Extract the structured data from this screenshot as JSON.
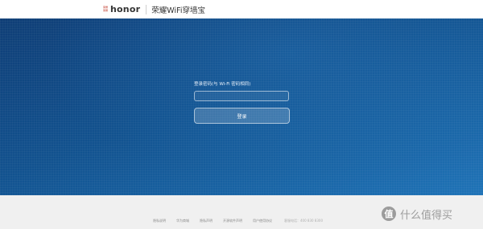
{
  "header": {
    "logo_mark_top": "荣耀",
    "logo_mark_bottom": "荣耀",
    "logo_word": "honor",
    "product_title": "荣耀WiFi穿墙宝"
  },
  "login": {
    "field_label": "登录密码(与 Wi-Fi 密码相同)",
    "password_value": "",
    "button_label": "登录"
  },
  "footer": {
    "links": [
      "隐私说明",
      "华为商城",
      "隐私声明",
      "开源软件声明",
      "用户使用协议"
    ],
    "hotline": "客服电话：400 830 8300"
  },
  "watermark": {
    "badge": "值",
    "text": "什么值得买"
  },
  "colors": {
    "hero_dark": "#0f3e76",
    "hero_light": "#1f73b7",
    "footer_bg": "#f0f0f0"
  }
}
